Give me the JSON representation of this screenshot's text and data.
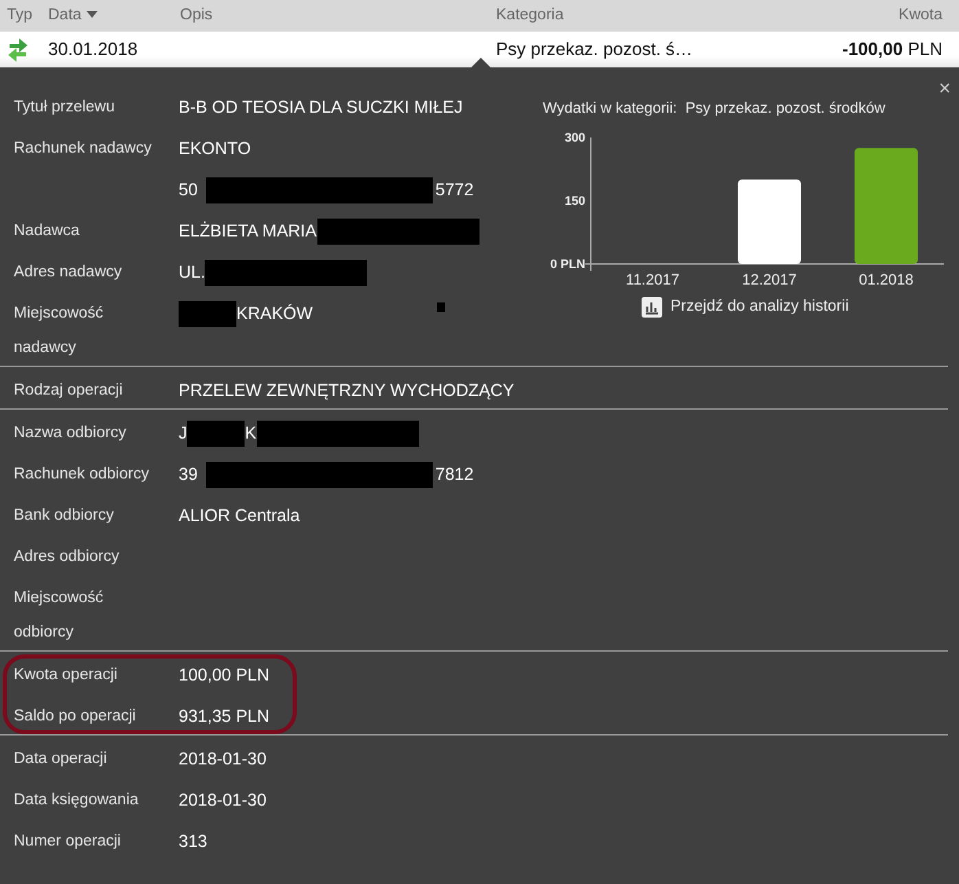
{
  "table": {
    "columns": [
      {
        "label": "Typ",
        "sorted": false
      },
      {
        "label": "Data",
        "sorted": true
      },
      {
        "label": "Opis",
        "sorted": false
      },
      {
        "label": "Kategoria",
        "sorted": false
      },
      {
        "label": "Kwota",
        "sorted": false
      }
    ],
    "row": {
      "date": "30.01.2018",
      "category": "Psy przekaz. pozost. ś…",
      "amount": "**-100,00** PLN",
      "expanded": true
    }
  },
  "details": {
    "close": "×",
    "sections": [
      {
        "rows": [
          {
            "label": "Tytuł przelewu",
            "value": [
              {
                "kind": "text",
                "text": "B-B OD TEOSIA DLA SUCZKI MIŁEJ"
              }
            ]
          },
          {
            "label": "Rachunek nadawcy",
            "value": [
              {
                "kind": "text",
                "text": "EKONTO"
              }
            ]
          },
          {
            "value": [
              {
                "kind": "text",
                "text": "50"
              },
              {
                "kind": "longbar"
              },
              {
                "kind": "text",
                "text": "5772"
              }
            ]
          },
          {
            "label": "Nadawca",
            "value": [
              {
                "kind": "text",
                "text": "ELŻBIETA MARIA"
              },
              {
                "kind": "bar"
              }
            ]
          },
          {
            "label": "Adres nadawcy",
            "value": [
              {
                "kind": "text",
                "text": "UL."
              },
              {
                "kind": "bar"
              }
            ]
          },
          {
            "label": "Miejscowość nadawcy",
            "value": [
              {
                "kind": "shortbar"
              },
              {
                "kind": "text",
                "text": "KRAKÓW"
              },
              {
                "kind": "dot"
              }
            ]
          }
        ]
      },
      {
        "rows": [
          {
            "label": "Rodzaj operacji",
            "value": [
              {
                "kind": "text",
                "text": "PRZELEW ZEWNĘTRZNY WYCHODZĄCY"
              }
            ]
          }
        ]
      },
      {
        "rows": [
          {
            "label": "Nazwa odbiorcy",
            "value": [
              {
                "kind": "text",
                "text": "J"
              },
              {
                "kind": "shortbar"
              },
              {
                "kind": "text",
                "text": "K"
              },
              {
                "kind": "bar"
              }
            ]
          },
          {
            "label": "Rachunek odbiorcy",
            "value": [
              {
                "kind": "text",
                "text": "39"
              },
              {
                "kind": "longbar"
              },
              {
                "kind": "text",
                "text": "7812"
              }
            ]
          },
          {
            "label": "Bank odbiorcy",
            "value": [
              {
                "kind": "text",
                "text": "ALIOR Centrala"
              }
            ]
          },
          {
            "label": "Adres odbiorcy",
            "value": []
          },
          {
            "label": "Miejscowość odbiorcy",
            "value": []
          }
        ]
      },
      {
        "highlighted": true,
        "rows": [
          {
            "label": "Kwota operacji",
            "value": [
              {
                "kind": "text",
                "text": "100,00 PLN"
              }
            ]
          },
          {
            "label": "Saldo po operacji",
            "value": [
              {
                "kind": "text",
                "text": "931,35 PLN"
              }
            ]
          }
        ]
      },
      {
        "rows": [
          {
            "label": "Data operacji",
            "value": [
              {
                "kind": "text",
                "text": "2018-01-30"
              }
            ]
          },
          {
            "label": "Data księgowania",
            "value": [
              {
                "kind": "text",
                "text": "2018-01-30"
              }
            ]
          },
          {
            "label": "Numer operacji",
            "value": [
              {
                "kind": "text",
                "text": "313"
              }
            ]
          }
        ]
      }
    ],
    "chart": {
      "label": "Wydatki w kategorii:",
      "category": "Psy przekaz. pozost. środków",
      "link": "Przejdź do analizy historii",
      "chart_data": {
        "type": "bar",
        "categories": [
          "11.2017",
          "12.2017",
          "01.2018"
        ],
        "series": [
          {
            "color": "#ffffff",
            "values": [
              0,
              200,
              null
            ]
          },
          {
            "color": "#6aaa1e",
            "values": [
              null,
              null,
              275
            ]
          }
        ],
        "ylim": [
          0,
          300
        ],
        "yticks": [
          {
            "value": 0,
            "label": "0 PLN"
          },
          150,
          300
        ]
      }
    }
  }
}
